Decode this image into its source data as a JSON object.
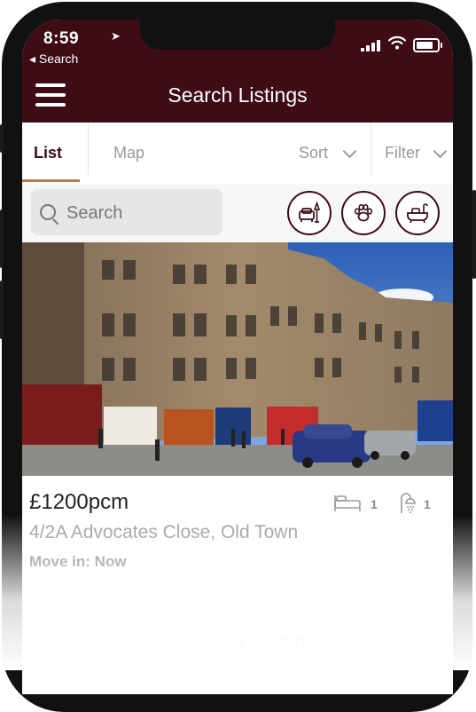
{
  "status_bar": {
    "time": "8:59",
    "location_arrow": "➤",
    "back_label": "◂ Search"
  },
  "header": {
    "title": "Search Listings"
  },
  "tabs": {
    "list": "List",
    "map": "Map",
    "sort": "Sort",
    "filter": "Filter"
  },
  "search": {
    "placeholder": "Search"
  },
  "filter_icons": [
    "furnished-icon",
    "pets-icon",
    "bathtub-icon"
  ],
  "listing": {
    "price": "£1200pcm",
    "bedrooms": "1",
    "bathrooms": "1",
    "address": "4/2A Advocates Close, Old Town",
    "move_in": "Move in: Now",
    "cta": "Request a viewing"
  },
  "colors": {
    "brand": "#3d0c14",
    "accent": "#c57744"
  }
}
